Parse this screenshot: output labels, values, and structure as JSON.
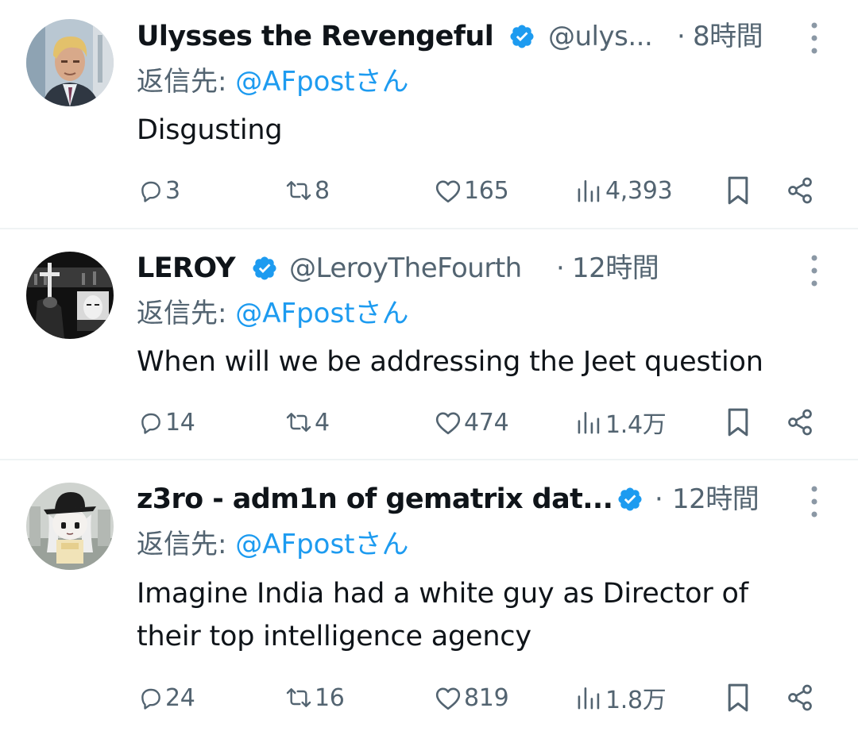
{
  "colors": {
    "text": "#0f1419",
    "muted": "#536471",
    "accent": "#1d9bf0",
    "verified": "#1d9bf0",
    "divider": "#eff3f4"
  },
  "tweets": [
    {
      "display_name": "Ulysses the Revengeful",
      "verified": true,
      "handle": "@ulys...",
      "separator": "·",
      "time": "8時間",
      "reply_label": "返信先: ",
      "reply_mention": "@AFpostさん",
      "text": "Disgusting",
      "avatar_icon": "avatar-blond-man-in-suit",
      "stats": {
        "replies": "3",
        "retweets": "8",
        "likes": "165",
        "views": "4,393"
      }
    },
    {
      "display_name": "LEROY",
      "verified": true,
      "handle": "@LeroyTheFourth",
      "separator": "·",
      "time": "12時間",
      "reply_label": "返信先: ",
      "reply_mention": "@AFpostさん",
      "text": "When will we be addressing the Jeet question",
      "avatar_icon": "avatar-dark-collage-with-cross",
      "stats": {
        "replies": "14",
        "retweets": "4",
        "likes": "474",
        "views": "1.4万"
      }
    },
    {
      "display_name": "z3ro - adm1n of gematrix dat...",
      "verified": true,
      "handle": "",
      "separator": "·",
      "time": "12時間",
      "reply_label": "返信先: ",
      "reply_mention": "@AFpostさん",
      "text": "Imagine India had a white guy as Director of their top intelligence agency",
      "avatar_icon": "avatar-anime-girl-with-hat",
      "stats": {
        "replies": "24",
        "retweets": "16",
        "likes": "819",
        "views": "1.8万"
      }
    }
  ]
}
